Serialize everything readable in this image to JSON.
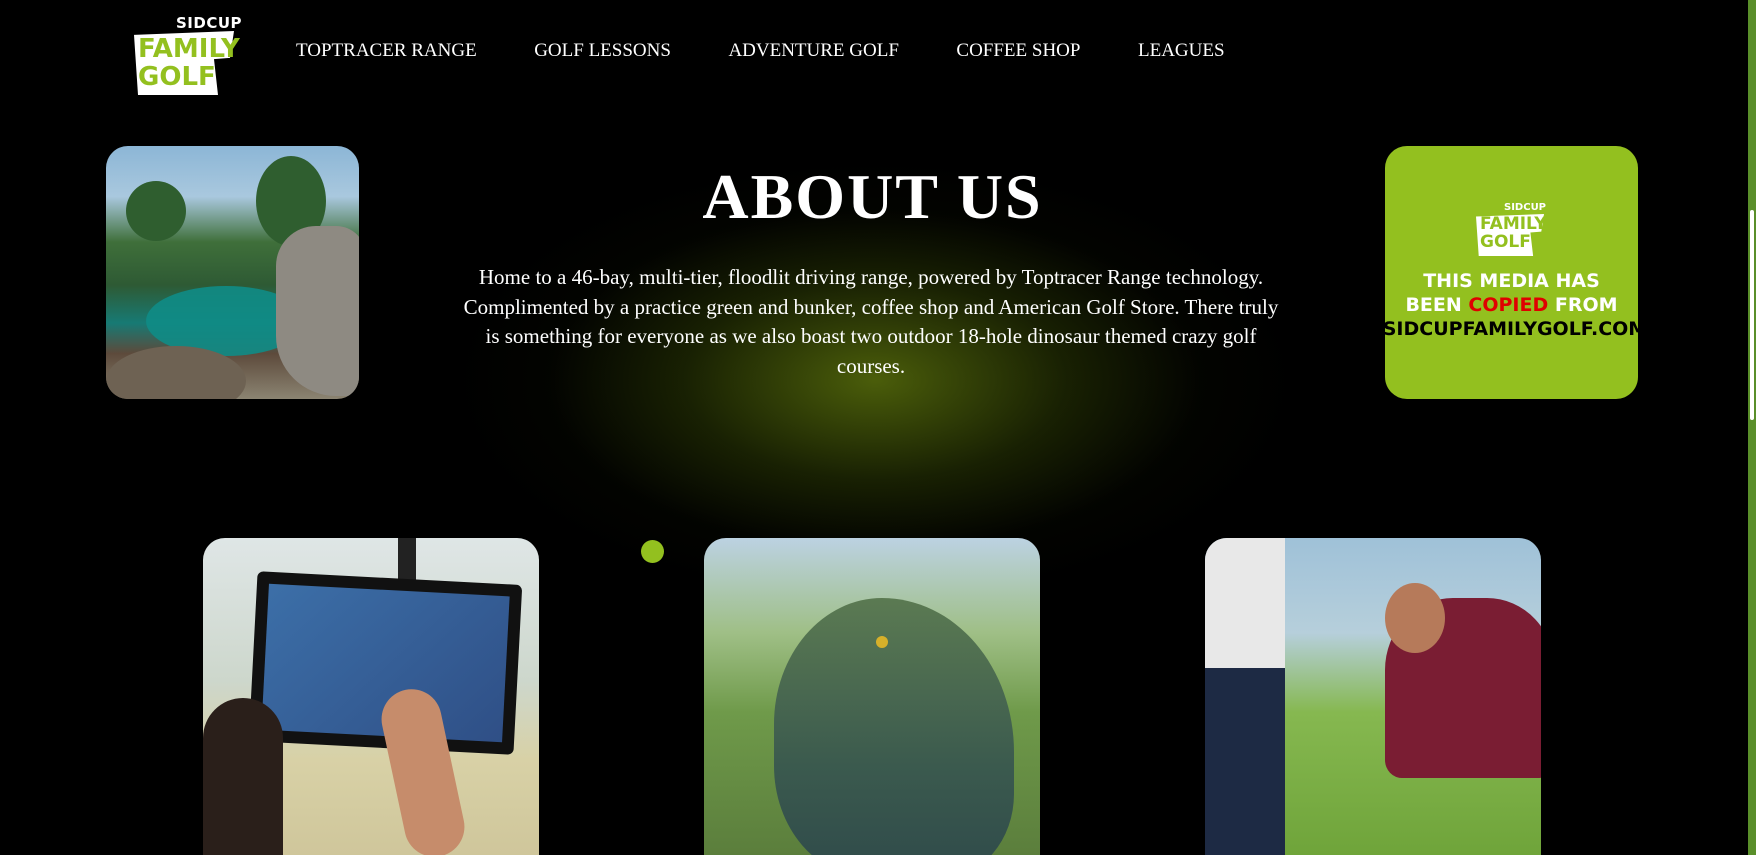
{
  "brand": {
    "top": "SIDCUP",
    "line1": "FAMILY",
    "line2": "GOLF"
  },
  "nav": [
    "TOPTRACER RANGE",
    "GOLF LESSONS",
    "ADVENTURE GOLF",
    "COFFEE SHOP",
    "LEAGUES"
  ],
  "about": {
    "heading": "ABOUT US",
    "body": "Home to a 46-bay, multi-tier, floodlit driving range, powered by Toptracer Range technology. Complimented by a practice green and bunker, coffee shop and American Golf Store. There truly is something for everyone as we also boast two outdoor 18-hole dinosaur themed crazy golf courses."
  },
  "watermark": {
    "line1": "THIS MEDIA HAS",
    "line2a": "BEEN ",
    "line2b": "COPIED",
    "line2c": " FROM",
    "line3": "SIDCUPFAMILYGOLF.COM"
  },
  "colors": {
    "accent": "#93c01f",
    "background": "#000000",
    "warning_red": "#e00000"
  }
}
